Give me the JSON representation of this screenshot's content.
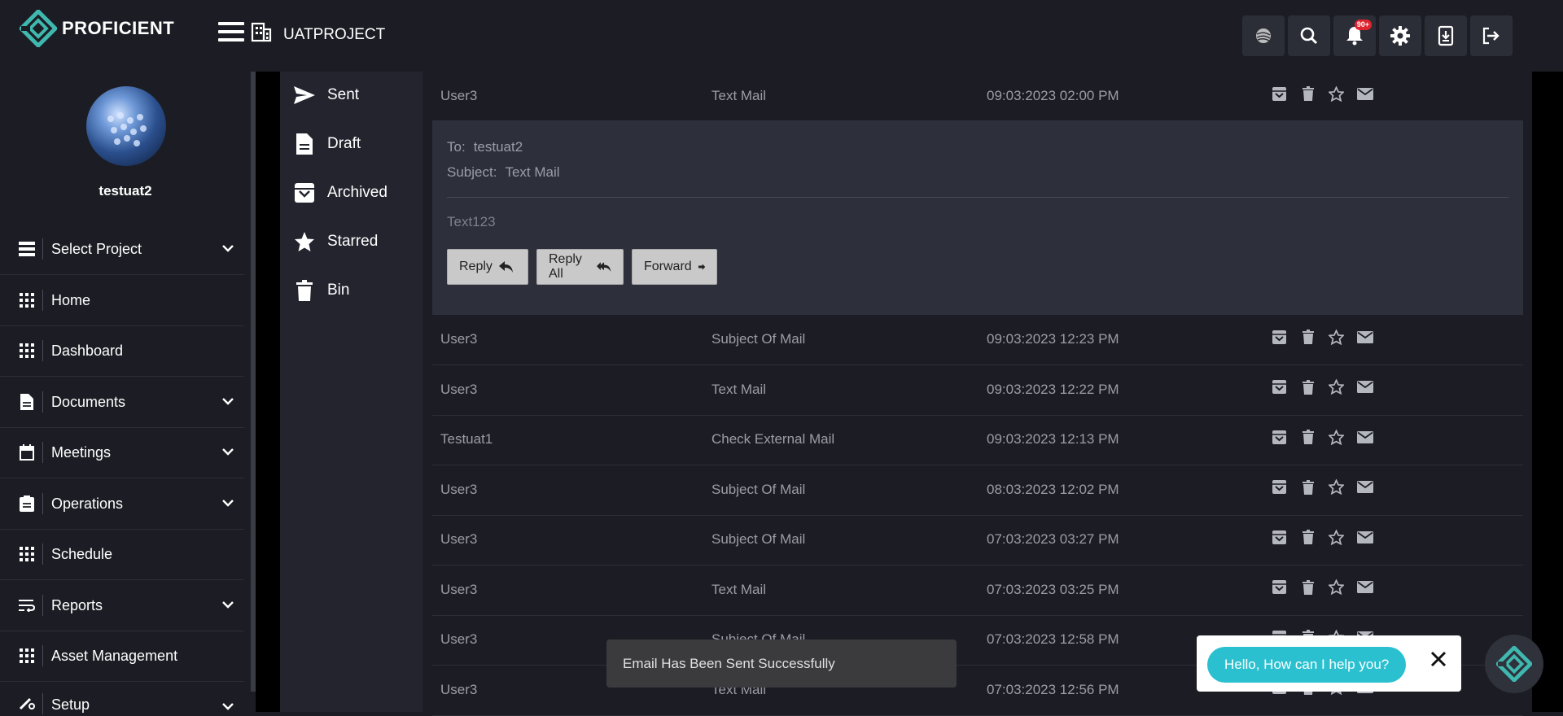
{
  "header": {
    "brand": "PROFICIENT",
    "project": "UATPROJECT",
    "notifications_badge": "90+",
    "buttons": [
      "globe-icon",
      "search-icon",
      "bell-icon",
      "gear-icon",
      "download-icon",
      "logout-icon"
    ]
  },
  "user": {
    "name": "testuat2"
  },
  "sidebar": {
    "items": [
      {
        "label": "Select Project",
        "icon": "list-icon",
        "chevron": true
      },
      {
        "label": "Home",
        "icon": "grid-icon",
        "chevron": false
      },
      {
        "label": "Dashboard",
        "icon": "grid-icon",
        "chevron": false
      },
      {
        "label": "Documents",
        "icon": "document-icon",
        "chevron": true
      },
      {
        "label": "Meetings",
        "icon": "calendar-icon",
        "chevron": true
      },
      {
        "label": "Operations",
        "icon": "clipboard-icon",
        "chevron": true
      },
      {
        "label": "Schedule",
        "icon": "grid-icon",
        "chevron": false
      },
      {
        "label": "Reports",
        "icon": "wrap-icon",
        "chevron": true
      },
      {
        "label": "Asset Management",
        "icon": "grid-icon",
        "chevron": false
      },
      {
        "label": "Setup",
        "icon": "tools-icon",
        "chevron": true
      }
    ]
  },
  "folders": [
    {
      "label": "Sent",
      "icon": "send-icon"
    },
    {
      "label": "Draft",
      "icon": "draft-icon"
    },
    {
      "label": "Archived",
      "icon": "archive-icon"
    },
    {
      "label": "Starred",
      "icon": "star-icon"
    },
    {
      "label": "Bin",
      "icon": "trash-icon"
    }
  ],
  "mails": [
    {
      "from": "User3",
      "subject": "Text Mail",
      "date": "09:03:2023 02:00 PM"
    },
    {
      "from": "User3",
      "subject": "Subject Of Mail",
      "date": "09:03:2023 12:23 PM"
    },
    {
      "from": "User3",
      "subject": "Text Mail",
      "date": "09:03:2023 12:22 PM"
    },
    {
      "from": "Testuat1",
      "subject": "Check External Mail",
      "date": "09:03:2023 12:13 PM"
    },
    {
      "from": "User3",
      "subject": "Subject Of Mail",
      "date": "08:03:2023 12:02 PM"
    },
    {
      "from": "User3",
      "subject": "Subject Of Mail",
      "date": "07:03:2023 03:27 PM"
    },
    {
      "from": "User3",
      "subject": "Text Mail",
      "date": "07:03:2023 03:25 PM"
    },
    {
      "from": "User3",
      "subject": "Subject Of Mail",
      "date": "07:03:2023 12:58 PM"
    },
    {
      "from": "User3",
      "subject": "Text Mail",
      "date": "07:03:2023 12:56 PM"
    }
  ],
  "preview": {
    "to_label": "To:",
    "to_value": "testuat2",
    "subject_label": "Subject:",
    "subject_value": "Text Mail",
    "body": "Text123",
    "reply": "Reply",
    "reply_all": "Reply All",
    "forward": "Forward"
  },
  "toast": "Email Has Been Sent Successfully",
  "chat": {
    "greeting": "Hello, How can I help you?"
  }
}
